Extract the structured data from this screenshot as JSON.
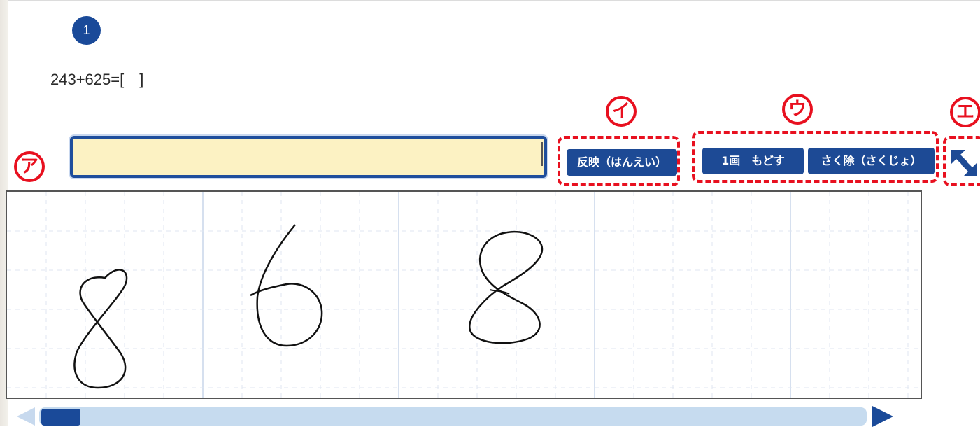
{
  "question": {
    "number": "1",
    "text": "243+625=[　]"
  },
  "answer_input": {
    "value": ""
  },
  "buttons": {
    "reflect_label": "反映（はんえい）",
    "undo_label": "1画　もどす",
    "delete_label": "さく除（さくじょ）",
    "expand_icon": "expand-arrows-icon"
  },
  "markers": {
    "a": "ア",
    "i": "イ",
    "u": "ウ",
    "e": "エ"
  },
  "handwriting": {
    "recognized_digits": [
      "8",
      "6",
      "8"
    ]
  },
  "colors": {
    "accent": "#1d4a95",
    "input_background": "#fcf2c3",
    "marker_red": "#e8101f",
    "scroll_track": "#c6dbef"
  }
}
